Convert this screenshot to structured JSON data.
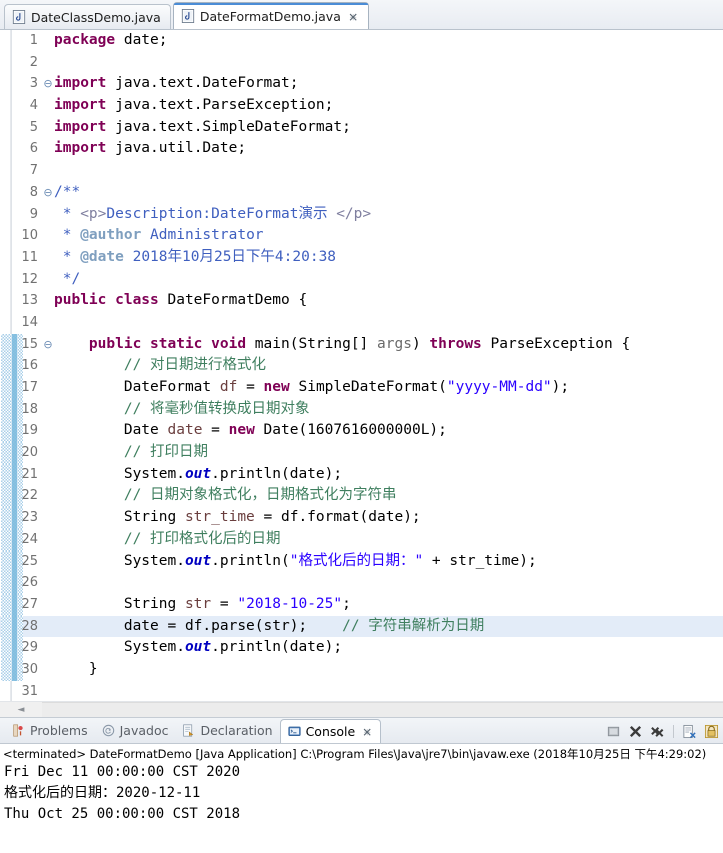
{
  "editor_tabs": [
    {
      "label": "DateClassDemo.java",
      "icon": "java-file-icon",
      "active": false,
      "closable": false
    },
    {
      "label": "DateFormatDemo.java",
      "icon": "java-file-icon",
      "active": true,
      "closable": true
    }
  ],
  "code_lines": [
    {
      "n": "1",
      "fold": "",
      "changed": false,
      "cursor": false,
      "tokens": [
        {
          "t": "kw",
          "v": "package"
        },
        {
          "t": "",
          "v": " date;"
        }
      ]
    },
    {
      "n": "2",
      "fold": "",
      "changed": false,
      "cursor": false,
      "tokens": []
    },
    {
      "n": "3",
      "fold": "⊖",
      "changed": false,
      "cursor": false,
      "tokens": [
        {
          "t": "kw",
          "v": "import"
        },
        {
          "t": "",
          "v": " java.text.DateFormat;"
        }
      ]
    },
    {
      "n": "4",
      "fold": "",
      "changed": false,
      "cursor": false,
      "tokens": [
        {
          "t": "kw",
          "v": "import"
        },
        {
          "t": "",
          "v": " java.text.ParseException;"
        }
      ]
    },
    {
      "n": "5",
      "fold": "",
      "changed": false,
      "cursor": false,
      "tokens": [
        {
          "t": "kw",
          "v": "import"
        },
        {
          "t": "",
          "v": " java.text.SimpleDateFormat;"
        }
      ]
    },
    {
      "n": "6",
      "fold": "",
      "changed": false,
      "cursor": false,
      "tokens": [
        {
          "t": "kw",
          "v": "import"
        },
        {
          "t": "",
          "v": " java.util.Date;"
        }
      ]
    },
    {
      "n": "7",
      "fold": "",
      "changed": false,
      "cursor": false,
      "tokens": []
    },
    {
      "n": "8",
      "fold": "⊖",
      "changed": false,
      "cursor": false,
      "tokens": [
        {
          "t": "doc",
          "v": "/**"
        }
      ]
    },
    {
      "n": "9",
      "fold": "",
      "changed": false,
      "cursor": false,
      "tokens": [
        {
          "t": "doc",
          "v": " * "
        },
        {
          "t": "dochtml",
          "v": "<p>"
        },
        {
          "t": "doc",
          "v": "Description:DateFormat演示 "
        },
        {
          "t": "dochtml",
          "v": "</p>"
        }
      ]
    },
    {
      "n": "10",
      "fold": "",
      "changed": false,
      "cursor": false,
      "tokens": [
        {
          "t": "doc",
          "v": " * "
        },
        {
          "t": "doctag",
          "v": "@author"
        },
        {
          "t": "doc",
          "v": " Administrator"
        }
      ]
    },
    {
      "n": "11",
      "fold": "",
      "changed": false,
      "cursor": false,
      "tokens": [
        {
          "t": "doc",
          "v": " * "
        },
        {
          "t": "doctag",
          "v": "@date"
        },
        {
          "t": "doc",
          "v": " 2018年10月25日下午4:20:38"
        }
      ]
    },
    {
      "n": "12",
      "fold": "",
      "changed": false,
      "cursor": false,
      "tokens": [
        {
          "t": "doc",
          "v": " */"
        }
      ]
    },
    {
      "n": "13",
      "fold": "",
      "changed": false,
      "cursor": false,
      "tokens": [
        {
          "t": "kw",
          "v": "public class"
        },
        {
          "t": "",
          "v": " DateFormatDemo {"
        }
      ]
    },
    {
      "n": "14",
      "fold": "",
      "changed": false,
      "cursor": false,
      "tokens": []
    },
    {
      "n": "15",
      "fold": "⊖",
      "changed": true,
      "cursor": false,
      "tokens": [
        {
          "t": "",
          "v": "    "
        },
        {
          "t": "kw",
          "v": "public static void"
        },
        {
          "t": "",
          "v": " main(String[] "
        },
        {
          "t": "prm",
          "v": "args"
        },
        {
          "t": "",
          "v": ") "
        },
        {
          "t": "kw",
          "v": "throws"
        },
        {
          "t": "",
          "v": " ParseException {"
        }
      ]
    },
    {
      "n": "16",
      "fold": "",
      "changed": true,
      "cursor": false,
      "tokens": [
        {
          "t": "",
          "v": "        "
        },
        {
          "t": "cmt",
          "v": "// 对日期进行格式化"
        }
      ]
    },
    {
      "n": "17",
      "fold": "",
      "changed": true,
      "cursor": false,
      "tokens": [
        {
          "t": "",
          "v": "        DateFormat "
        },
        {
          "t": "lvar",
          "v": "df"
        },
        {
          "t": "",
          "v": " = "
        },
        {
          "t": "kw",
          "v": "new"
        },
        {
          "t": "",
          "v": " SimpleDateFormat("
        },
        {
          "t": "str",
          "v": "\"yyyy-MM-dd\""
        },
        {
          "t": "",
          "v": ");"
        }
      ]
    },
    {
      "n": "18",
      "fold": "",
      "changed": true,
      "cursor": false,
      "tokens": [
        {
          "t": "",
          "v": "        "
        },
        {
          "t": "cmt",
          "v": "// 将毫秒值转换成日期对象"
        }
      ]
    },
    {
      "n": "19",
      "fold": "",
      "changed": true,
      "cursor": false,
      "tokens": [
        {
          "t": "",
          "v": "        Date "
        },
        {
          "t": "lvar",
          "v": "date"
        },
        {
          "t": "",
          "v": " = "
        },
        {
          "t": "kw",
          "v": "new"
        },
        {
          "t": "",
          "v": " Date(1607616000000L);"
        }
      ]
    },
    {
      "n": "20",
      "fold": "",
      "changed": true,
      "cursor": false,
      "tokens": [
        {
          "t": "",
          "v": "        "
        },
        {
          "t": "cmt",
          "v": "// 打印日期"
        }
      ]
    },
    {
      "n": "21",
      "fold": "",
      "changed": true,
      "cursor": false,
      "tokens": [
        {
          "t": "",
          "v": "        System."
        },
        {
          "t": "sfld",
          "v": "out"
        },
        {
          "t": "",
          "v": ".println(date);"
        }
      ]
    },
    {
      "n": "22",
      "fold": "",
      "changed": true,
      "cursor": false,
      "tokens": [
        {
          "t": "",
          "v": "        "
        },
        {
          "t": "cmt",
          "v": "// 日期对象格式化，日期格式化为字符串"
        }
      ]
    },
    {
      "n": "23",
      "fold": "",
      "changed": true,
      "cursor": false,
      "tokens": [
        {
          "t": "",
          "v": "        String "
        },
        {
          "t": "lvar",
          "v": "str_time"
        },
        {
          "t": "",
          "v": " = df.format(date);"
        }
      ]
    },
    {
      "n": "24",
      "fold": "",
      "changed": true,
      "cursor": false,
      "tokens": [
        {
          "t": "",
          "v": "        "
        },
        {
          "t": "cmt",
          "v": "// 打印格式化后的日期"
        }
      ]
    },
    {
      "n": "25",
      "fold": "",
      "changed": true,
      "cursor": false,
      "tokens": [
        {
          "t": "",
          "v": "        System."
        },
        {
          "t": "sfld",
          "v": "out"
        },
        {
          "t": "",
          "v": ".println("
        },
        {
          "t": "str",
          "v": "\"格式化后的日期：\""
        },
        {
          "t": "",
          "v": " + str_time);"
        }
      ]
    },
    {
      "n": "26",
      "fold": "",
      "changed": true,
      "cursor": false,
      "tokens": []
    },
    {
      "n": "27",
      "fold": "",
      "changed": true,
      "cursor": false,
      "tokens": [
        {
          "t": "",
          "v": "        String "
        },
        {
          "t": "lvar",
          "v": "str"
        },
        {
          "t": "",
          "v": " = "
        },
        {
          "t": "str",
          "v": "\"2018-10-25\""
        },
        {
          "t": "",
          "v": ";"
        }
      ]
    },
    {
      "n": "28",
      "fold": "",
      "changed": true,
      "cursor": true,
      "tokens": [
        {
          "t": "",
          "v": "        date = df.parse(str);    "
        },
        {
          "t": "cmt",
          "v": "// 字符串解析为日期"
        }
      ]
    },
    {
      "n": "29",
      "fold": "",
      "changed": true,
      "cursor": false,
      "tokens": [
        {
          "t": "",
          "v": "        System."
        },
        {
          "t": "sfld",
          "v": "out"
        },
        {
          "t": "",
          "v": ".println(date);"
        }
      ]
    },
    {
      "n": "30",
      "fold": "",
      "changed": true,
      "cursor": false,
      "tokens": [
        {
          "t": "",
          "v": "    }"
        }
      ]
    },
    {
      "n": "31",
      "fold": "",
      "changed": false,
      "cursor": false,
      "tokens": []
    }
  ],
  "console": {
    "tabs": [
      {
        "label": "Problems",
        "icon": "problems-icon",
        "active": false,
        "closable": false
      },
      {
        "label": "Javadoc",
        "icon": "javadoc-icon",
        "active": false,
        "closable": false
      },
      {
        "label": "Declaration",
        "icon": "declaration-icon",
        "active": false,
        "closable": false
      },
      {
        "label": "Console",
        "icon": "console-icon",
        "active": true,
        "closable": true
      }
    ],
    "toolbar": [
      {
        "name": "terminate-button"
      },
      {
        "name": "remove-launch-button"
      },
      {
        "name": "remove-all-terminated-button"
      },
      {
        "name": "toolbar-separator"
      },
      {
        "name": "clear-console-button"
      },
      {
        "name": "scroll-lock-button"
      }
    ],
    "terminated_line": "<terminated> DateFormatDemo [Java Application] C:\\Program Files\\Java\\jre7\\bin\\javaw.exe (2018年10月25日 下午4:29:02)",
    "output": [
      "Fri Dec 11 00:00:00 CST 2020",
      "格式化后的日期：2020-12-11",
      "Thu Oct 25 00:00:00 CST 2018"
    ]
  },
  "colors": {
    "keyword": "#7f0055",
    "string": "#2a00ff",
    "comment": "#3f7f5f",
    "javadoc": "#3f5fbf",
    "javadoc_tag": "#7f9fbf",
    "static_field": "#0000c0",
    "cursor_line": "#e3ecf8",
    "change_bar": "#79b8dd",
    "active_tab_accent": "#4a8cd6"
  }
}
